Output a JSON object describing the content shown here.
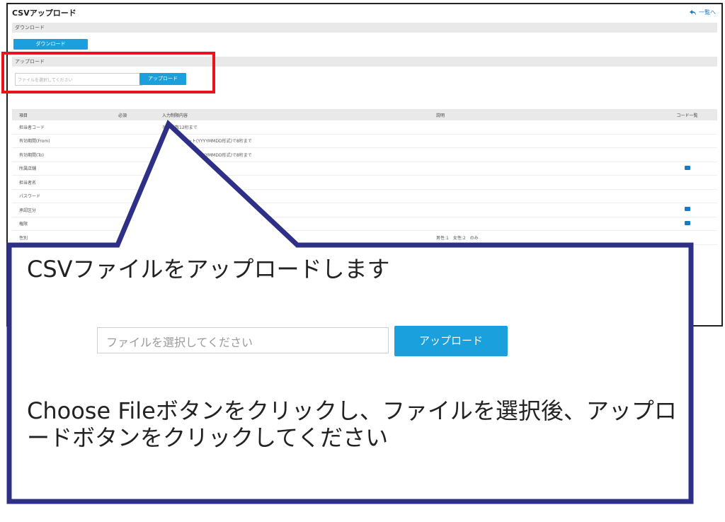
{
  "screen": {
    "title": "CSVアップロード",
    "back_label": "一覧へ",
    "download_section": "ダウンロード",
    "download_button": "ダウンロード",
    "upload_section": "アップロード",
    "file_placeholder": "ファイルを選択してください",
    "upload_button": "アップロード",
    "table": {
      "headers": [
        "項目",
        "必須",
        "入力制限内容",
        "説明",
        "コード一覧"
      ],
      "rows": [
        {
          "item": "担当者コード",
          "limit": "半角英数12桁まで",
          "desc": "",
          "code": false
        },
        {
          "item": "有効期間(From)",
          "limit": "日付フォーマット(YYYYMMDD形式)で8桁まで",
          "desc": "",
          "code": false
        },
        {
          "item": "有効期間(To)",
          "limit": "日付フォーマット(YYYYMMDD形式)で8桁まで",
          "desc": "",
          "code": false
        },
        {
          "item": "所属店舗",
          "limit": "",
          "desc": "",
          "code": true
        },
        {
          "item": "担当者名",
          "limit": "",
          "desc": "",
          "code": false
        },
        {
          "item": "パスワード",
          "limit": "",
          "desc": "",
          "code": false
        },
        {
          "item": "承認区分",
          "limit": "",
          "desc": "",
          "code": true
        },
        {
          "item": "権限",
          "limit": "",
          "desc": "",
          "code": true
        },
        {
          "item": "性別",
          "limit": "",
          "desc": "男性:1　女性:2　のみ",
          "code": false
        }
      ]
    }
  },
  "callout": {
    "heading": "CSVファイルをアップロードします",
    "file_placeholder": "ファイルを選択してください",
    "upload_button": "アップロード",
    "body": "Choose Fileボタンをクリックし、ファイルを選択後、アップロードボタンをクリックしてください"
  },
  "colors": {
    "accent": "#1aa0dc",
    "highlight": "#e8141b",
    "callout_border": "#2e2f87"
  }
}
